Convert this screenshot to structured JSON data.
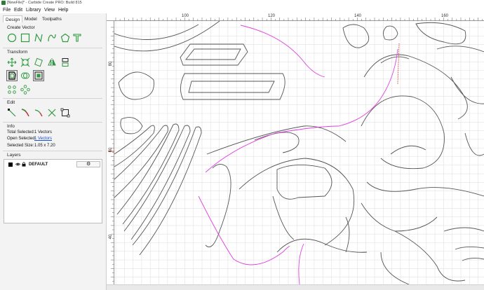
{
  "window": {
    "title": "[NewFile]* - Carbide Create PRO: Build 815"
  },
  "menu": [
    "File",
    "Edit",
    "Library",
    "View",
    "Help"
  ],
  "tabs": [
    {
      "label": "Design",
      "active": true
    },
    {
      "label": "Model",
      "active": false
    },
    {
      "label": "Toolpaths",
      "active": false
    }
  ],
  "sections": {
    "create_vector": "Create Vector",
    "transform": "Transform",
    "edit": "Edit",
    "info": "Info",
    "layers": "Layers"
  },
  "create_tools": [
    "circle-icon",
    "rectangle-icon",
    "polyline-icon",
    "curve-icon",
    "polygon-icon",
    "text-icon"
  ],
  "transform_tools": [
    "move-icon",
    "scale-icon",
    "rotate-icon",
    "mirror-icon",
    "align-icon",
    "offset-icon",
    "boolean-icon",
    "fit-icon",
    "array-grid-icon",
    "circular-array-icon"
  ],
  "edit_tools": [
    "node-edit-icon",
    "trim-icon",
    "join-icon",
    "cut-icon",
    "bounding-icon"
  ],
  "info": {
    "total_selected_label": "Total Selected:",
    "total_selected_value": "1 Vectors",
    "open_selected_label": "Open Selected:",
    "open_selected_value": "1 Vectors",
    "selected_size_label": "Selected Size:",
    "selected_size_value": "1.05 x 7.20"
  },
  "layers": [
    {
      "name": "DEFAULT",
      "color": "#000000",
      "visible": true,
      "locked": true
    }
  ],
  "ruler": {
    "top_labels": [
      "100",
      "120",
      "140",
      "160"
    ],
    "left_labels": [
      "80",
      "60",
      "40"
    ]
  },
  "colors": {
    "accent_green": "#2e9a3e",
    "selected_path": "#e040e0",
    "path": "#555555",
    "grid": "#e2e2e2",
    "cursor_red": "#d33b2c"
  }
}
